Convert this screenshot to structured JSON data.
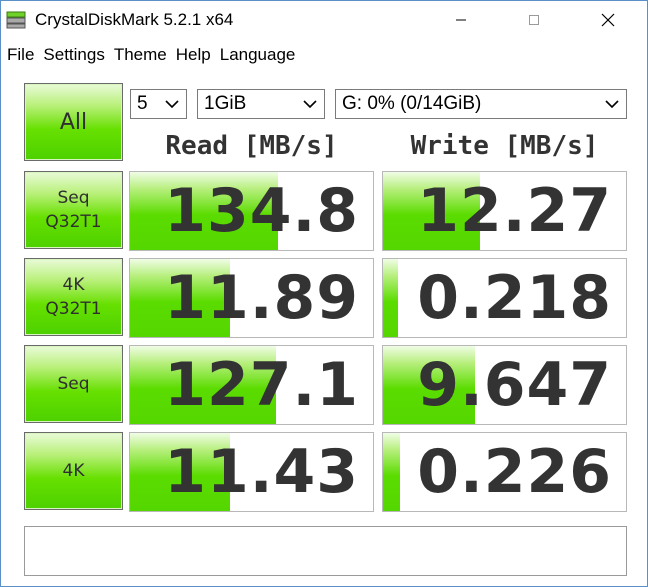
{
  "window": {
    "title": "CrystalDiskMark 5.2.1 x64"
  },
  "menu": [
    "File",
    "Settings",
    "Theme",
    "Help",
    "Language"
  ],
  "controls": {
    "all_label": "All",
    "count": "5",
    "size": "1GiB",
    "drive": "G: 0% (0/14GiB)"
  },
  "headers": {
    "read": "Read [MB/s]",
    "write": "Write [MB/s]"
  },
  "tests": [
    {
      "label_line1": "Seq",
      "label_line2": "Q32T1",
      "read": "134.8",
      "write": "12.27",
      "read_fill_pct": 61,
      "write_fill_pct": 40
    },
    {
      "label_line1": "4K",
      "label_line2": "Q32T1",
      "read": "11.89",
      "write": "0.218",
      "read_fill_pct": 41,
      "write_fill_pct": 6
    },
    {
      "label_line1": "Seq",
      "label_line2": "",
      "read": "127.1",
      "write": "9.647",
      "read_fill_pct": 60,
      "write_fill_pct": 38
    },
    {
      "label_line1": "4K",
      "label_line2": "",
      "read": "11.43",
      "write": "0.226",
      "read_fill_pct": 41,
      "write_fill_pct": 7
    }
  ],
  "comment": "",
  "colors": {
    "accent_green": "#54d600",
    "border_blue": "#5a8fc8"
  }
}
